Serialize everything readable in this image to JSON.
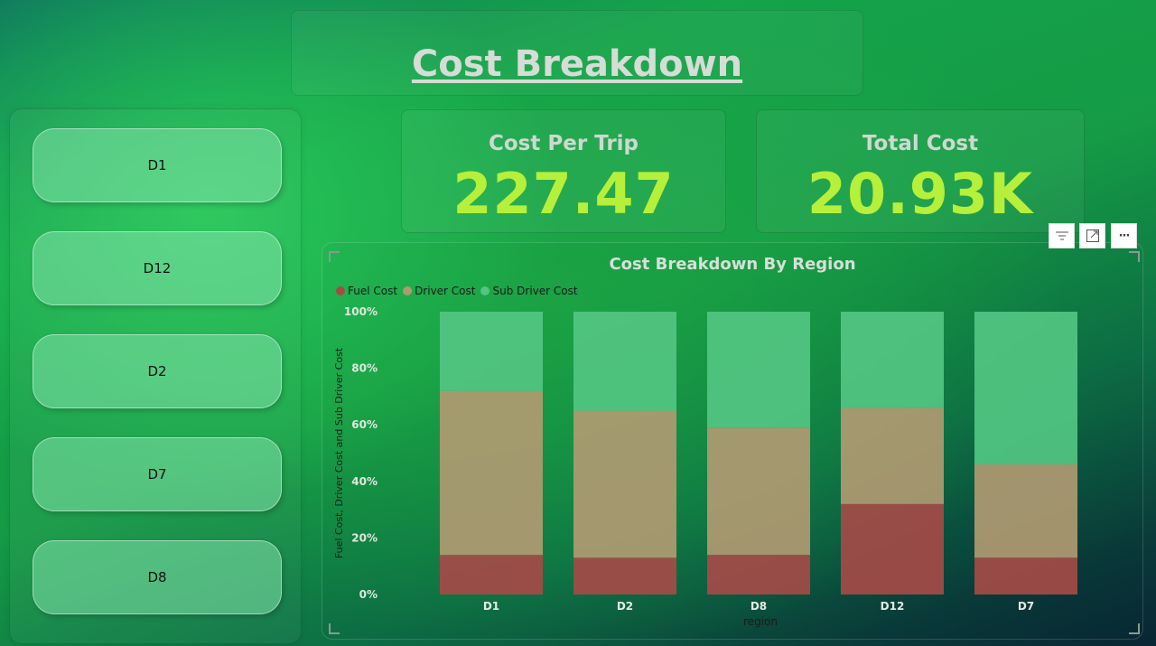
{
  "header": {
    "title": " Cost Breakdown"
  },
  "slicer": {
    "items": [
      "D1",
      "D12",
      "D2",
      "D7",
      "D8"
    ]
  },
  "kpis": [
    {
      "label": "Cost Per Trip",
      "value": "227.47"
    },
    {
      "label": "Total Cost",
      "value": "20.93K"
    }
  ],
  "toolbar": {
    "icons": [
      "filter-icon",
      "focus-mode-icon",
      "more-options-icon"
    ],
    "more_label": "···"
  },
  "chart_data": {
    "type": "bar",
    "stacked": "100%",
    "title": "Cost Breakdown By Region",
    "xlabel": "region",
    "ylabel": "Fuel Cost, Driver Cost and Sub Driver Cost",
    "categories": [
      "D1",
      "D2",
      "D8",
      "D12",
      "D7"
    ],
    "yticks": [
      "0%",
      "20%",
      "40%",
      "60%",
      "80%",
      "100%"
    ],
    "ylim": [
      0,
      100
    ],
    "legend_position": "top-left",
    "series": [
      {
        "name": "Fuel Cost",
        "color": "#a44b48",
        "values": [
          14,
          13,
          14,
          32,
          13
        ]
      },
      {
        "name": "Driver Cost",
        "color": "#b09a72",
        "values": [
          58,
          52,
          45,
          34,
          33
        ]
      },
      {
        "name": "Sub Driver Cost",
        "color": "#52c582",
        "values": [
          28,
          35,
          41,
          34,
          54
        ]
      }
    ]
  }
}
